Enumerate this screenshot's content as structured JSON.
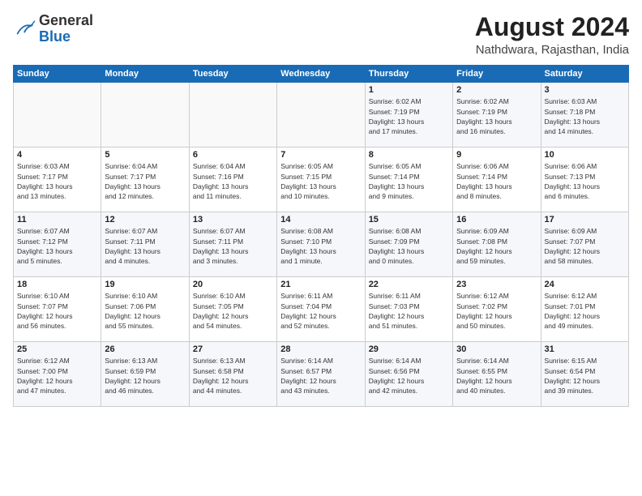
{
  "logo": {
    "general": "General",
    "blue": "Blue"
  },
  "header": {
    "month_year": "August 2024",
    "location": "Nathdwara, Rajasthan, India"
  },
  "days_of_week": [
    "Sunday",
    "Monday",
    "Tuesday",
    "Wednesday",
    "Thursday",
    "Friday",
    "Saturday"
  ],
  "weeks": [
    [
      {
        "day": "",
        "info": ""
      },
      {
        "day": "",
        "info": ""
      },
      {
        "day": "",
        "info": ""
      },
      {
        "day": "",
        "info": ""
      },
      {
        "day": "1",
        "info": "Sunrise: 6:02 AM\nSunset: 7:19 PM\nDaylight: 13 hours\nand 17 minutes."
      },
      {
        "day": "2",
        "info": "Sunrise: 6:02 AM\nSunset: 7:19 PM\nDaylight: 13 hours\nand 16 minutes."
      },
      {
        "day": "3",
        "info": "Sunrise: 6:03 AM\nSunset: 7:18 PM\nDaylight: 13 hours\nand 14 minutes."
      }
    ],
    [
      {
        "day": "4",
        "info": "Sunrise: 6:03 AM\nSunset: 7:17 PM\nDaylight: 13 hours\nand 13 minutes."
      },
      {
        "day": "5",
        "info": "Sunrise: 6:04 AM\nSunset: 7:17 PM\nDaylight: 13 hours\nand 12 minutes."
      },
      {
        "day": "6",
        "info": "Sunrise: 6:04 AM\nSunset: 7:16 PM\nDaylight: 13 hours\nand 11 minutes."
      },
      {
        "day": "7",
        "info": "Sunrise: 6:05 AM\nSunset: 7:15 PM\nDaylight: 13 hours\nand 10 minutes."
      },
      {
        "day": "8",
        "info": "Sunrise: 6:05 AM\nSunset: 7:14 PM\nDaylight: 13 hours\nand 9 minutes."
      },
      {
        "day": "9",
        "info": "Sunrise: 6:06 AM\nSunset: 7:14 PM\nDaylight: 13 hours\nand 8 minutes."
      },
      {
        "day": "10",
        "info": "Sunrise: 6:06 AM\nSunset: 7:13 PM\nDaylight: 13 hours\nand 6 minutes."
      }
    ],
    [
      {
        "day": "11",
        "info": "Sunrise: 6:07 AM\nSunset: 7:12 PM\nDaylight: 13 hours\nand 5 minutes."
      },
      {
        "day": "12",
        "info": "Sunrise: 6:07 AM\nSunset: 7:11 PM\nDaylight: 13 hours\nand 4 minutes."
      },
      {
        "day": "13",
        "info": "Sunrise: 6:07 AM\nSunset: 7:11 PM\nDaylight: 13 hours\nand 3 minutes."
      },
      {
        "day": "14",
        "info": "Sunrise: 6:08 AM\nSunset: 7:10 PM\nDaylight: 13 hours\nand 1 minute."
      },
      {
        "day": "15",
        "info": "Sunrise: 6:08 AM\nSunset: 7:09 PM\nDaylight: 13 hours\nand 0 minutes."
      },
      {
        "day": "16",
        "info": "Sunrise: 6:09 AM\nSunset: 7:08 PM\nDaylight: 12 hours\nand 59 minutes."
      },
      {
        "day": "17",
        "info": "Sunrise: 6:09 AM\nSunset: 7:07 PM\nDaylight: 12 hours\nand 58 minutes."
      }
    ],
    [
      {
        "day": "18",
        "info": "Sunrise: 6:10 AM\nSunset: 7:07 PM\nDaylight: 12 hours\nand 56 minutes."
      },
      {
        "day": "19",
        "info": "Sunrise: 6:10 AM\nSunset: 7:06 PM\nDaylight: 12 hours\nand 55 minutes."
      },
      {
        "day": "20",
        "info": "Sunrise: 6:10 AM\nSunset: 7:05 PM\nDaylight: 12 hours\nand 54 minutes."
      },
      {
        "day": "21",
        "info": "Sunrise: 6:11 AM\nSunset: 7:04 PM\nDaylight: 12 hours\nand 52 minutes."
      },
      {
        "day": "22",
        "info": "Sunrise: 6:11 AM\nSunset: 7:03 PM\nDaylight: 12 hours\nand 51 minutes."
      },
      {
        "day": "23",
        "info": "Sunrise: 6:12 AM\nSunset: 7:02 PM\nDaylight: 12 hours\nand 50 minutes."
      },
      {
        "day": "24",
        "info": "Sunrise: 6:12 AM\nSunset: 7:01 PM\nDaylight: 12 hours\nand 49 minutes."
      }
    ],
    [
      {
        "day": "25",
        "info": "Sunrise: 6:12 AM\nSunset: 7:00 PM\nDaylight: 12 hours\nand 47 minutes."
      },
      {
        "day": "26",
        "info": "Sunrise: 6:13 AM\nSunset: 6:59 PM\nDaylight: 12 hours\nand 46 minutes."
      },
      {
        "day": "27",
        "info": "Sunrise: 6:13 AM\nSunset: 6:58 PM\nDaylight: 12 hours\nand 44 minutes."
      },
      {
        "day": "28",
        "info": "Sunrise: 6:14 AM\nSunset: 6:57 PM\nDaylight: 12 hours\nand 43 minutes."
      },
      {
        "day": "29",
        "info": "Sunrise: 6:14 AM\nSunset: 6:56 PM\nDaylight: 12 hours\nand 42 minutes."
      },
      {
        "day": "30",
        "info": "Sunrise: 6:14 AM\nSunset: 6:55 PM\nDaylight: 12 hours\nand 40 minutes."
      },
      {
        "day": "31",
        "info": "Sunrise: 6:15 AM\nSunset: 6:54 PM\nDaylight: 12 hours\nand 39 minutes."
      }
    ]
  ]
}
